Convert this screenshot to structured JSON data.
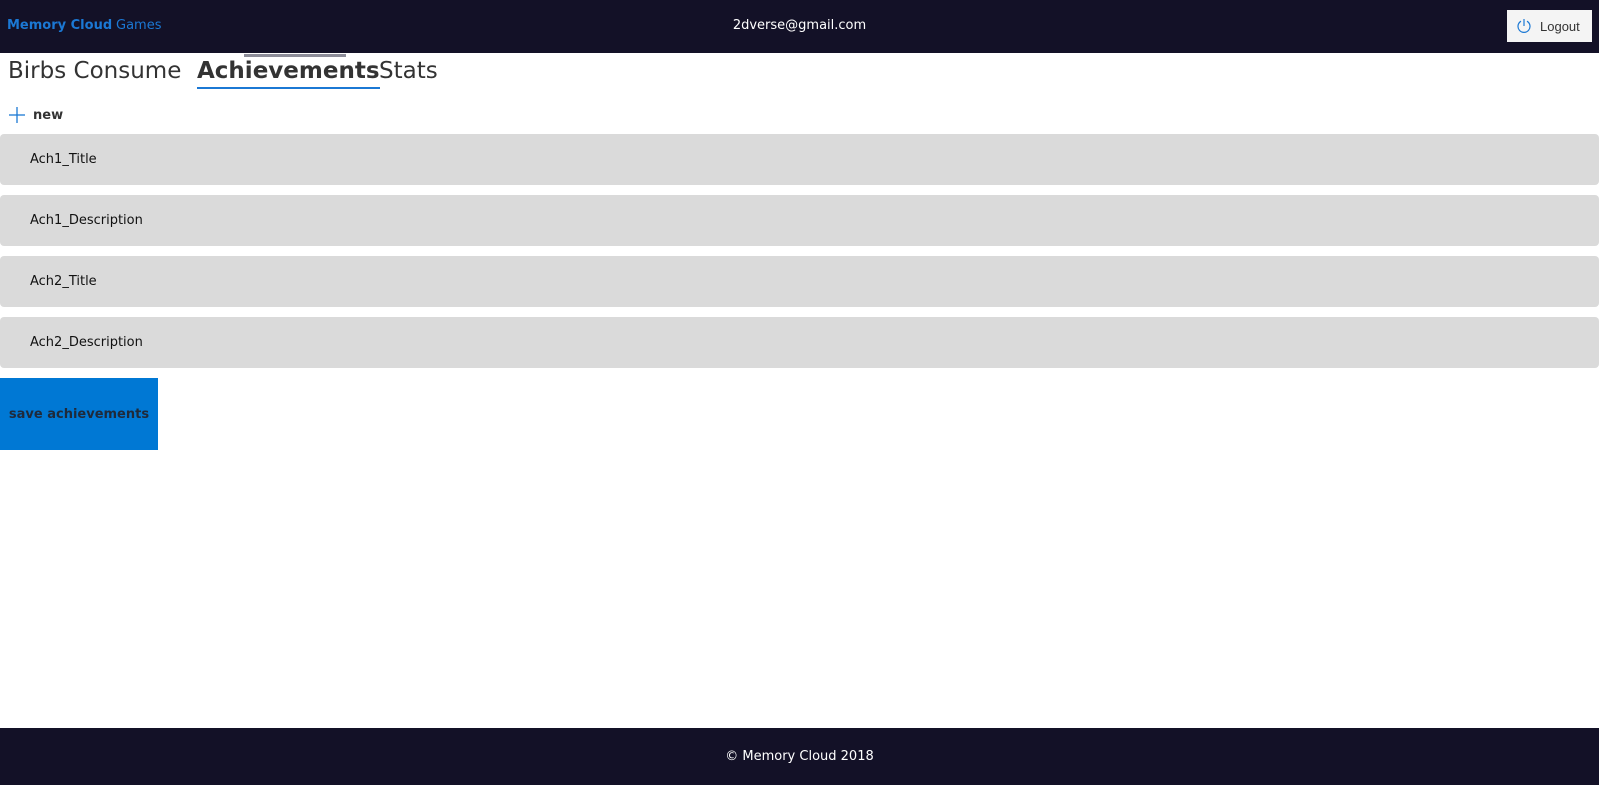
{
  "header": {
    "brand": "Memory Cloud",
    "games_link": "Games",
    "user_email": "2dverse@gmail.com",
    "logout_label": "Logout"
  },
  "tabs": [
    {
      "label": "Birbs Consume",
      "active": false
    },
    {
      "label": "Achievements",
      "active": true
    },
    {
      "label": "Stats",
      "active": false
    }
  ],
  "toolbar": {
    "new_label": "new"
  },
  "fields": [
    {
      "value": "Ach1_Title"
    },
    {
      "value": "Ach1_Description"
    },
    {
      "value": "Ach2_Title"
    },
    {
      "value": "Ach2_Description"
    }
  ],
  "actions": {
    "save_label": "save achievements"
  },
  "footer": {
    "text": "© Memory Cloud 2018"
  },
  "colors": {
    "nav_background": "#131127",
    "accent": "#1b78d4",
    "save_button": "#0078d4",
    "field_background": "#dadada"
  },
  "icons": {
    "logout": "power-icon",
    "new": "plus-icon"
  }
}
